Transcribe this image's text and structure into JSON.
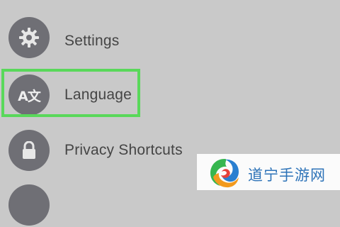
{
  "menu": {
    "items": [
      {
        "label": "Settings",
        "icon": "gear-icon"
      },
      {
        "label": "Language",
        "icon": "translate-icon",
        "icon_text": "A文"
      },
      {
        "label": "Privacy Shortcuts",
        "icon": "lock-icon"
      }
    ]
  },
  "colors": {
    "background": "#c9c9c9",
    "icon_circle": "#6f6f75",
    "highlight": "#59d85a"
  },
  "watermark": {
    "text": "道宁手游网",
    "logo": "swirl-logo-icon"
  }
}
